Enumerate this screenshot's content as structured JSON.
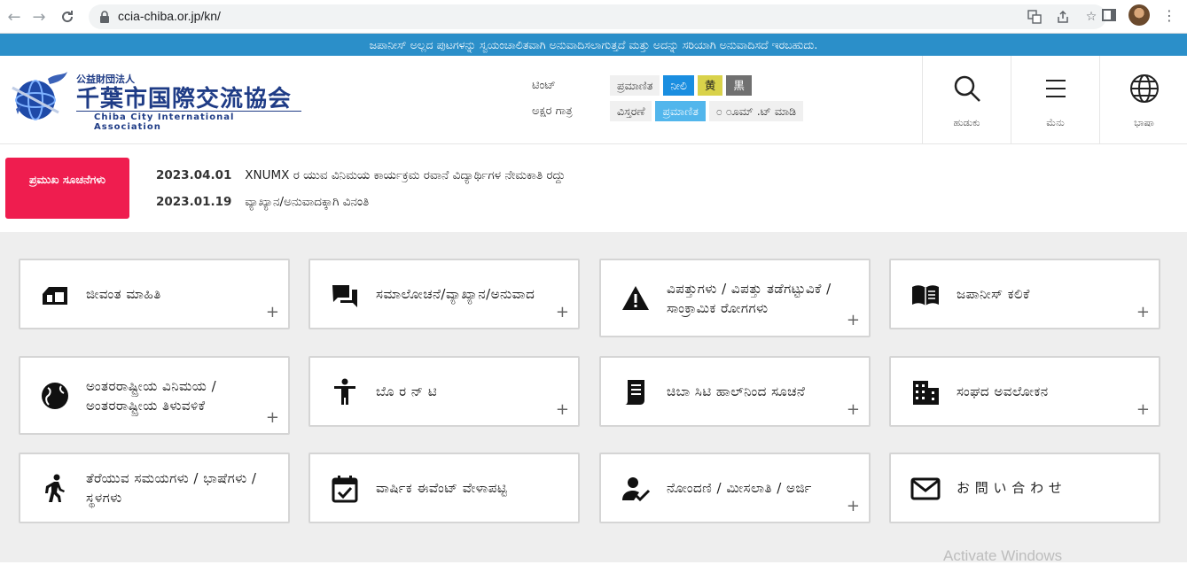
{
  "browser": {
    "url": "ccia-chiba.or.jp/kn/"
  },
  "banner": {
    "text": "ಜಪಾನೀಸ್ ಅಲ್ಲದ ಪುಟಗಳನ್ನು ಸ್ವಯಂಚಾಲಿತವಾಗಿ ಅನುವಾದಿಸಲಾಗುತ್ತದೆ ಮತ್ತು ಅದನ್ನು ಸರಿಯಾಗಿ ಅನುವಾದಿಸದೆ ಇರಬಹುದು."
  },
  "logo": {
    "small": "公益財団法人",
    "main": "千葉市国際交流協会",
    "english": "Chiba City International Association"
  },
  "tint": {
    "label": "ಟಿಂಟ್",
    "options": [
      "ಪ್ರಮಾಣಿತ",
      "ನೀಲಿ",
      "黄",
      "黒"
    ]
  },
  "font_size": {
    "label": "ಅಕ್ಷರ ಗಾತ್ರ",
    "options": [
      "ವಿಸ್ತರಣೆ",
      "ಪ್ರಮಾಣಿತ",
      "೦ ೦ೂಮ್ .ಟ್ ಮಾಡಿ"
    ]
  },
  "header_buttons": {
    "search": "ಹುಡುಕು",
    "menu": "ಮೆನು",
    "language": "ಭಾಷಾ"
  },
  "news": {
    "badge": "ಪ್ರಮುಖ ಸೂಚನೆಗಳು",
    "items": [
      {
        "date": "2023.04.01",
        "title": "XNUMX ರ ಯುವ ವಿನಿಮಯ ಕಾರ್ಯಕ್ರಮ ರವಾನೆ ವಿದ್ಯಾರ್ಥಿಗಳ ನೇಮಕಾತಿ ರದ್ದು"
      },
      {
        "date": "2023.01.19",
        "title": "ವ್ಯಾಖ್ಯಾನ/ಅನುವಾದಕ್ಕಾಗಿ ವಿನಂತಿ"
      }
    ]
  },
  "cards": [
    {
      "label": "ಜೀವಂತ ಮಾಹಿತಿ",
      "icon": "house-icon"
    },
    {
      "label": "ಸಮಾಲೋಚನೆ/ವ್ಯಾಖ್ಯಾನ/ಅನುವಾದ",
      "icon": "chat-icon"
    },
    {
      "label": "ವಿಪತ್ತುಗಳು / ವಿಪತ್ತು ತಡೆಗಟ್ಟುವಿಕೆ / ಸಾಂಕ್ರಾಮಿಕ ರೋಗಗಳು",
      "icon": "warning-icon"
    },
    {
      "label": "ಜಪಾನೀಸ್ ಕಲಿಕೆ",
      "icon": "book-icon"
    },
    {
      "label": "ಅಂತರರಾಷ್ಟ್ರೀಯ ವಿನಿಮಯ / ಅಂತರರಾಷ್ಟ್ರೀಯ ತಿಳುವಳಿಕೆ",
      "icon": "globe-icon"
    },
    {
      "label": "ಬೊ ರ ನ್ ಟಿ",
      "icon": "person-icon"
    },
    {
      "label": "ಚಿಬಾ ಸಿಟಿ ಹಾಲ್‌ನಿಂದ ಸೂಚನೆ",
      "icon": "notice-icon"
    },
    {
      "label": "ಸಂಘದ ಅವಲೋಕನ",
      "icon": "building-icon"
    },
    {
      "label": "ತೆರೆಯುವ ಸಮಯಗಳು / ಭಾಷೆಗಳು / ಸ್ಥಳಗಳು",
      "icon": "walk-icon"
    },
    {
      "label": "ವಾರ್ಷಿಕ ಈವೆಂಟ್ ವೇಳಾಪಟ್ಟಿ",
      "icon": "calendar-icon"
    },
    {
      "label": "ನೋಂದಣಿ / ಮೀಸಲಾತಿ / ಅರ್ಜಿ",
      "icon": "user-check-icon"
    },
    {
      "label": "お 問 い 合 わ せ",
      "icon": "mail-icon"
    }
  ],
  "watermark": "Activate Windows",
  "colors": {
    "banner": "#2b8fc9",
    "badge": "#ef1d4f",
    "logo": "#1f3c86",
    "tint_blue": "#1a8ee0",
    "tint_yellow": "#d9d24a",
    "tint_black": "#707070",
    "size_active": "#52b6ec"
  }
}
